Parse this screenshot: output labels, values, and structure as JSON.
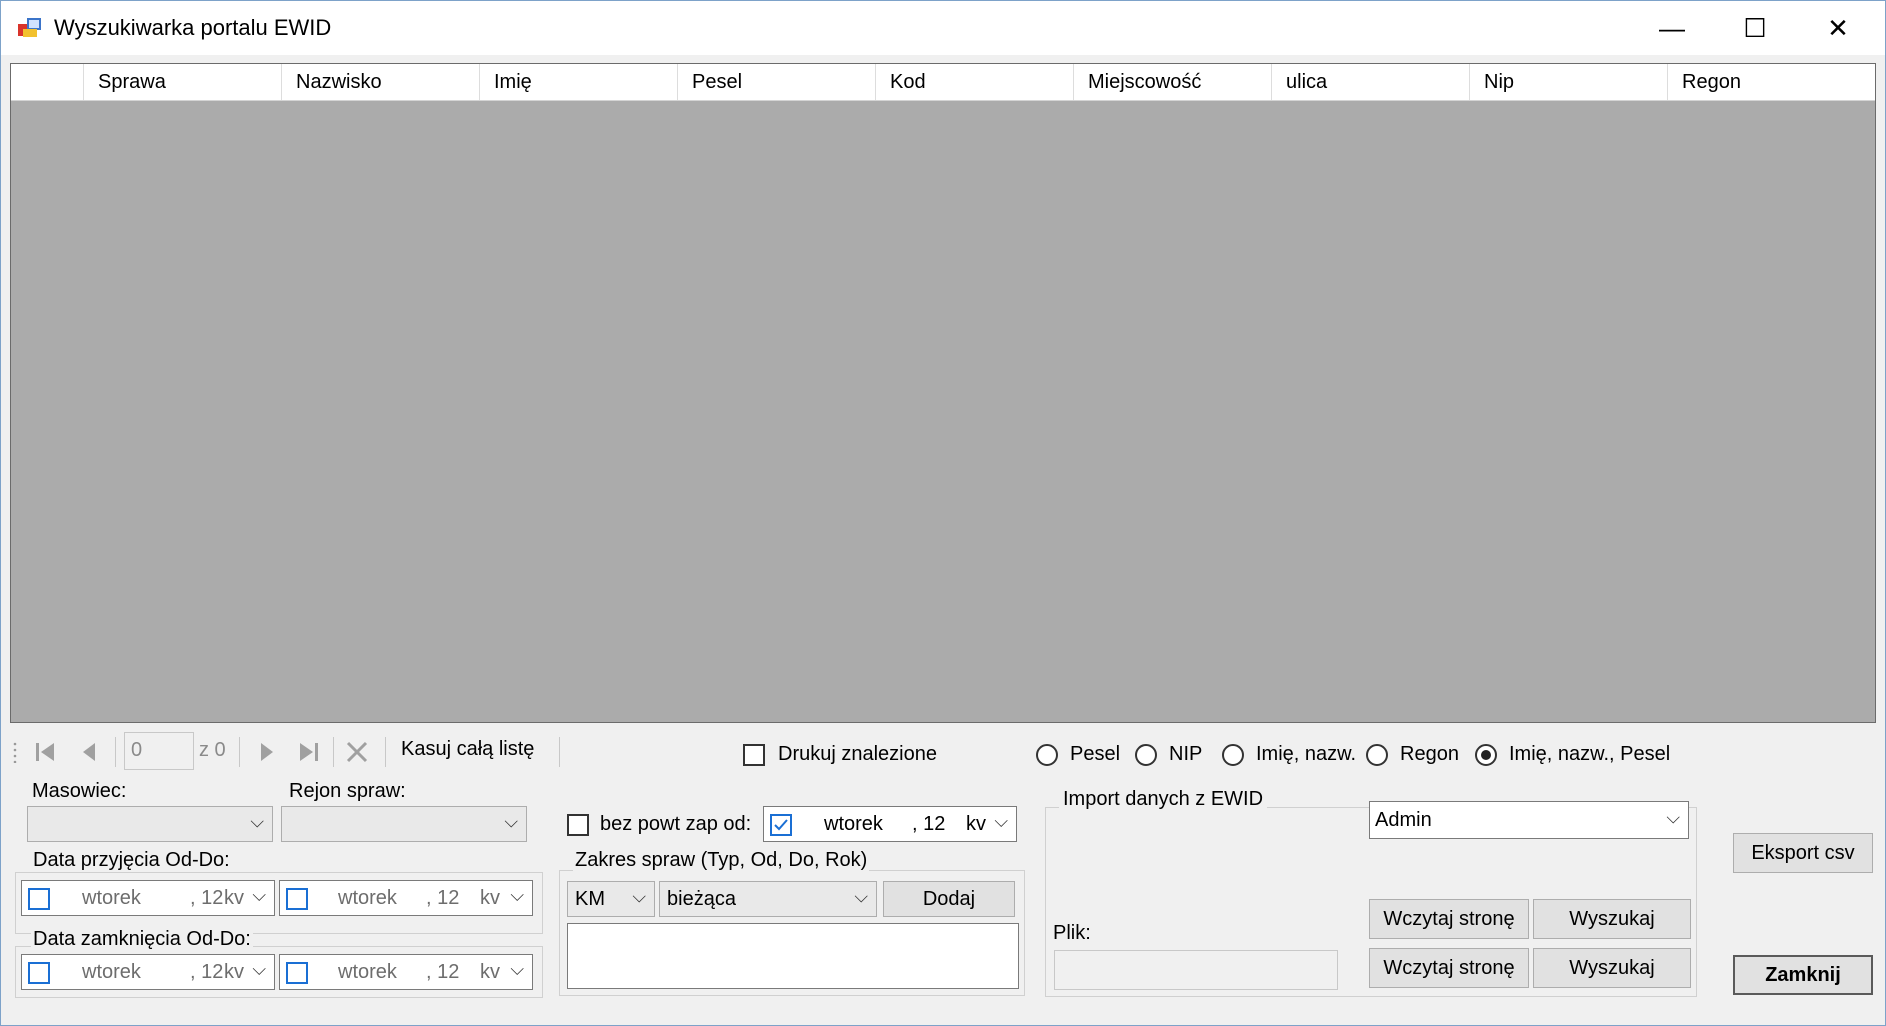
{
  "window": {
    "title": "Wyszukiwarka portalu EWID",
    "minimize_glyph": "—",
    "maximize_glyph": "☐",
    "close_glyph": "✕"
  },
  "grid": {
    "columns": [
      "Sprawa",
      "Nazwisko",
      "Imię",
      "Pesel",
      "Kod",
      "Miejscowość",
      "ulica",
      "Nip",
      "Regon"
    ]
  },
  "navigator": {
    "position_value": "0",
    "count_label": "z 0",
    "clear_all_label": "Kasuj całą listę"
  },
  "print_found": {
    "label": "Drukuj znalezione",
    "checked": false
  },
  "search_mode": {
    "options": [
      "Pesel",
      "NIP",
      "Imię, nazw.",
      "Regon",
      "Imię, nazw., Pesel"
    ],
    "selected": "Imię, nazw., Pesel"
  },
  "filters": {
    "masowiec_label": "Masowiec:",
    "rejon_label": "Rejon spraw:",
    "date_received_label": "Data przyjęcia Od-Do:",
    "date_closed_label": "Data zamknięcia Od-Do:",
    "date_day": "wtorek",
    "date_num": ", 12",
    "date_month": "kv"
  },
  "repeat": {
    "label": "bez powt zap od:",
    "checked": false,
    "date_checked": true
  },
  "case_range": {
    "label": "Zakres spraw (Typ, Od, Do, Rok)",
    "type_value": "KM",
    "year_value": "bieżąca",
    "add_label": "Dodaj"
  },
  "import": {
    "label": "Import danych z EWID",
    "user_value": "Admin",
    "file_label": "Plik:",
    "load_page_label": "Wczytaj stronę",
    "search_label": "Wyszukaj"
  },
  "actions": {
    "export_label": "Eksport csv",
    "close_label": "Zamknij"
  }
}
